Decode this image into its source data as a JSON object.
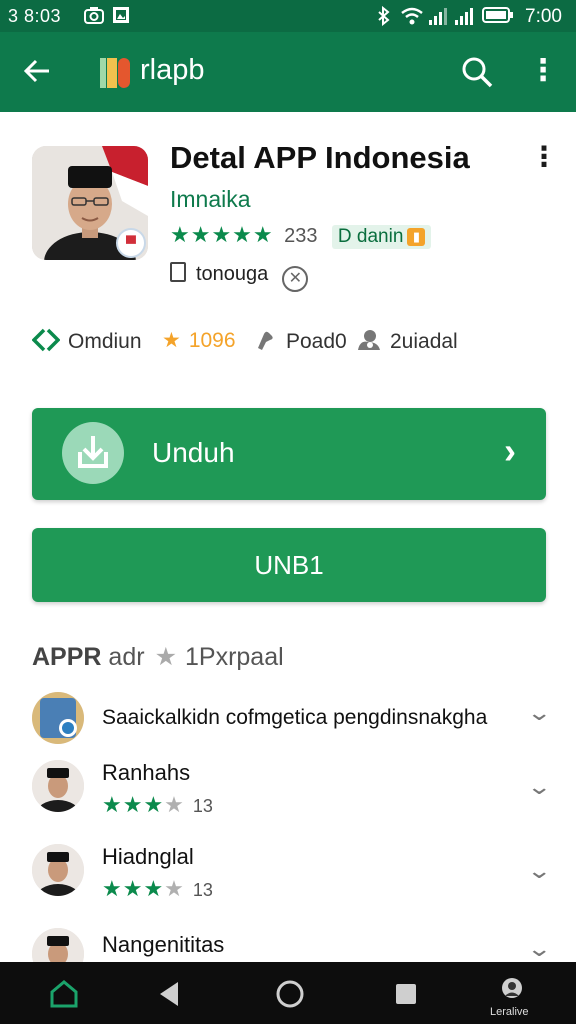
{
  "status_bar": {
    "time_left": "3 8:03",
    "time_right": "7:00",
    "icons": [
      "camera-icon",
      "photo-icon",
      "bluetooth-icon",
      "wifi-icon",
      "signal-icon",
      "signal-icon",
      "battery-icon"
    ]
  },
  "app_bar": {
    "brand": "rlapb",
    "icons": [
      "back-arrow-icon",
      "brand-logo-icon",
      "search-icon",
      "more-vert-icon"
    ]
  },
  "app": {
    "title": "Detal APP Indonesia",
    "developer": "Imnaika",
    "rating_count": "233",
    "chip_label": "danin",
    "chip_prefix": "D",
    "meta_label": "tonouga"
  },
  "stats": {
    "downloads_label": "Omdiun",
    "rating_value": "1096",
    "stat3": "Poad0",
    "stat4": "2uiadal"
  },
  "buttons": {
    "primary_label": "Unduh",
    "secondary_label": "UNB1"
  },
  "reviews": {
    "header_bold": "APPR",
    "header_mid": "adr",
    "header_tail": "1Pxrpaal",
    "items": [
      {
        "name": "Saaickalkidn cofmgetica pengdinsnakgha",
        "stars": null,
        "count": null
      },
      {
        "name": "Ranhahs",
        "stars": 3,
        "count": "13"
      },
      {
        "name": "Hiadnglal",
        "stars": 3,
        "count": "13"
      },
      {
        "name": "Nangenititas",
        "stars": null,
        "count": null
      }
    ]
  },
  "nav_bar": {
    "profile_label": "Leralive",
    "icons": [
      "home-icon",
      "back-triangle-icon",
      "home-circle-icon",
      "recents-square-icon",
      "profile-icon"
    ]
  },
  "colors": {
    "primary_green": "#0e7a4c",
    "button_green": "#1f9956",
    "star_green": "#0b8a4c",
    "star_gold": "#f4a32a"
  }
}
